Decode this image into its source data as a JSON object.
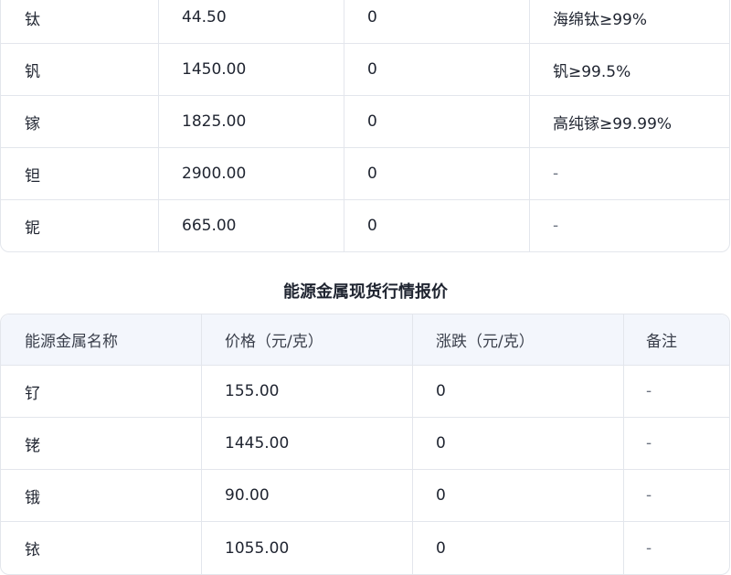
{
  "table1": {
    "rows": [
      [
        "钛",
        "44.50",
        "0",
        "海绵钛≥99%"
      ],
      [
        "钒",
        "1450.00",
        "0",
        "钒≥99.5%"
      ],
      [
        "镓",
        "1825.00",
        "0",
        "高纯镓≥99.99%"
      ],
      [
        "钽",
        "2900.00",
        "0",
        "-"
      ],
      [
        "铌",
        "665.00",
        "0",
        "-"
      ]
    ]
  },
  "section_title": "能源金属现货行情报价",
  "table2": {
    "headers": [
      "能源金属名称",
      "价格（元/克）",
      "涨跌（元/克）",
      "备注"
    ],
    "rows": [
      [
        "钌",
        "155.00",
        "0",
        "-"
      ],
      [
        "铑",
        "1445.00",
        "0",
        "-"
      ],
      [
        "锇",
        "90.00",
        "0",
        "-"
      ],
      [
        "铱",
        "1055.00",
        "0",
        "-"
      ]
    ]
  }
}
